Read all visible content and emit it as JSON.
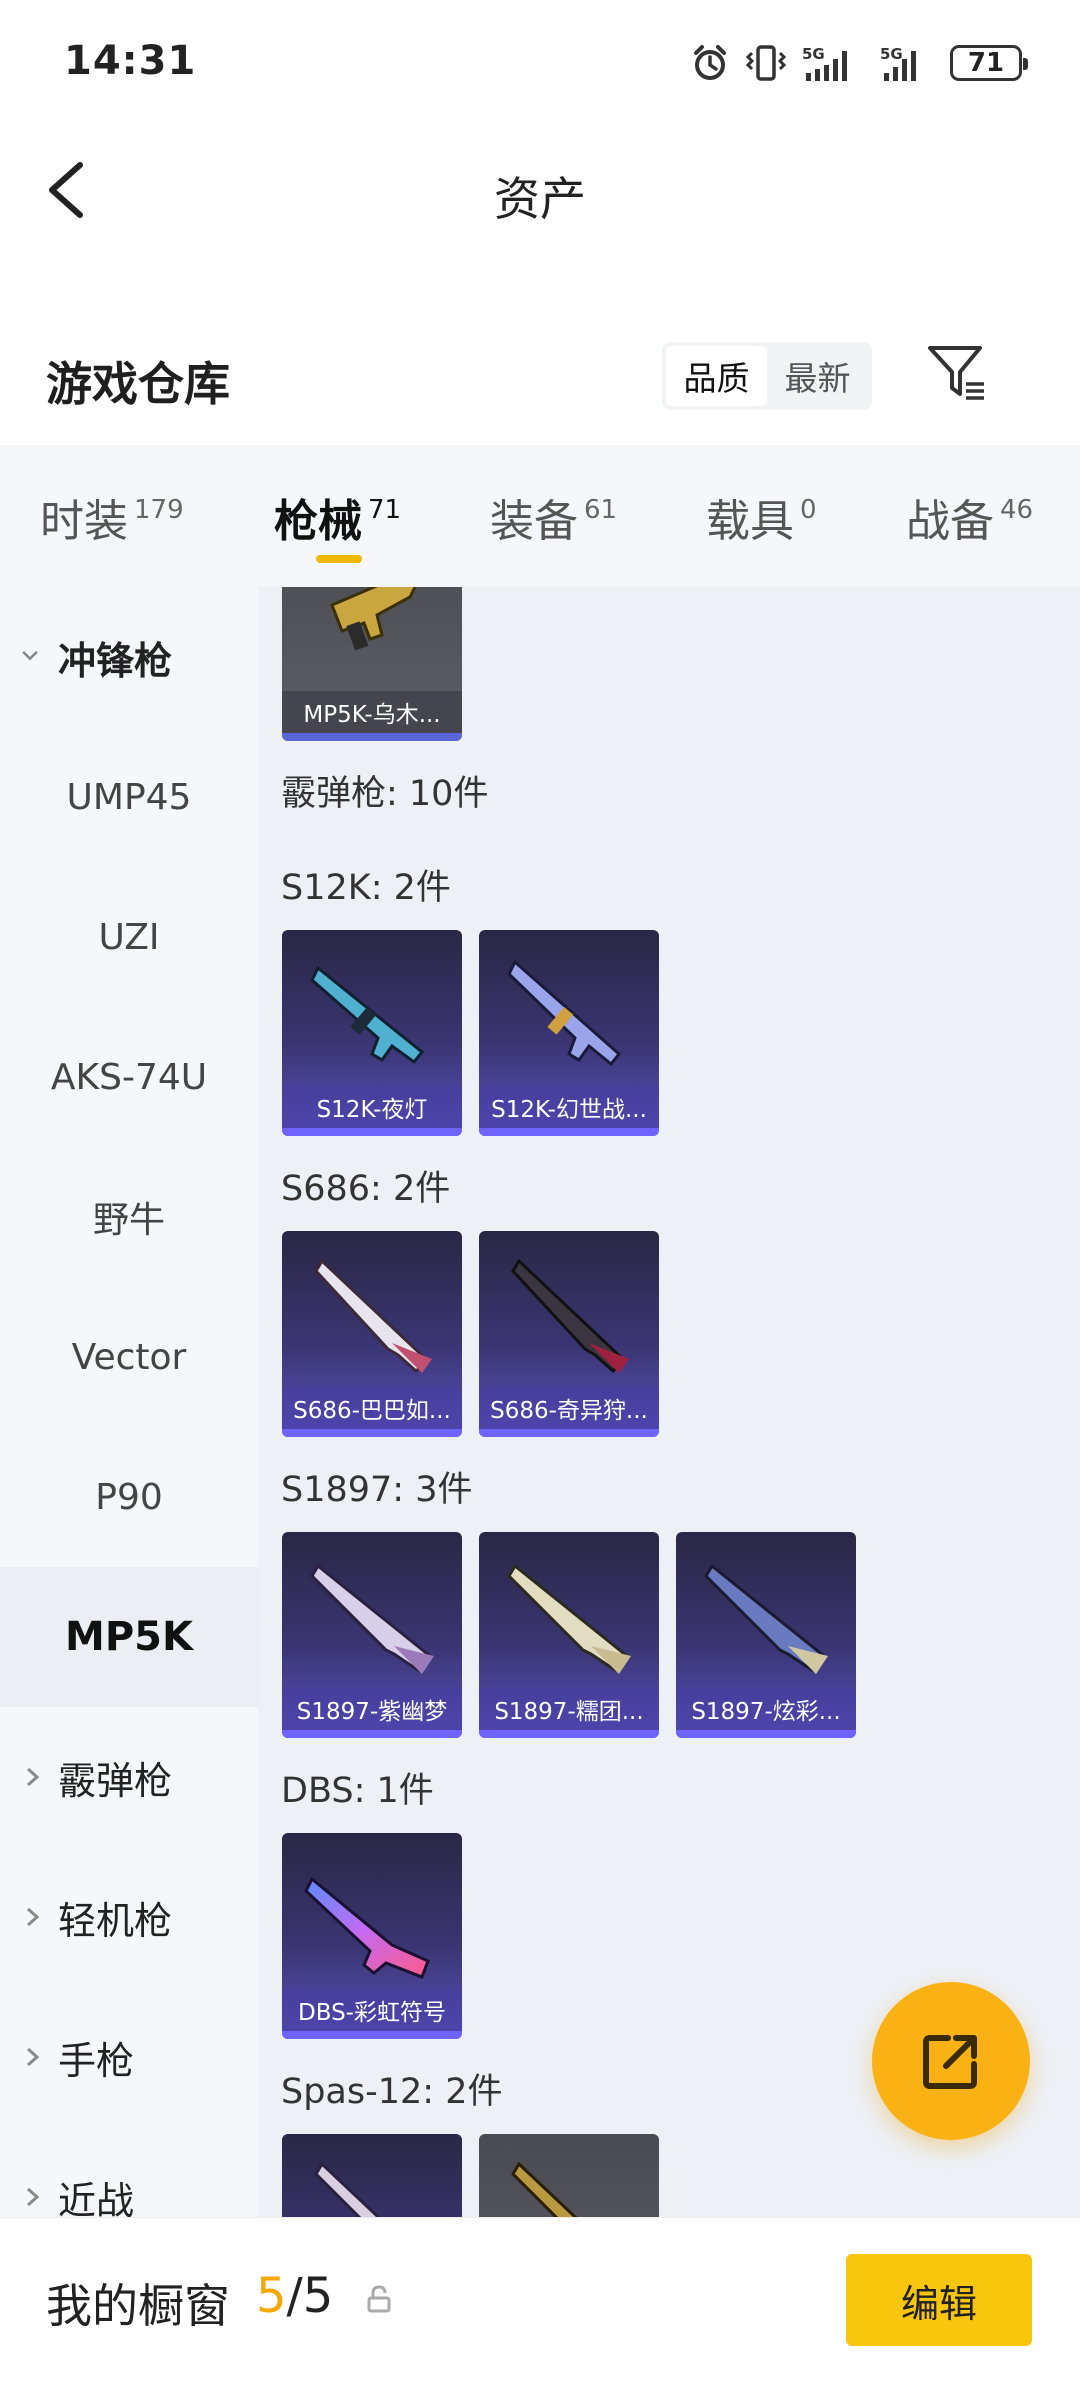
{
  "status_bar": {
    "time": "14:31",
    "battery": "71"
  },
  "nav": {
    "title": "资产"
  },
  "warehouse": {
    "title": "游戏仓库",
    "sort_options": [
      {
        "label": "品质",
        "active": true
      },
      {
        "label": "最新",
        "active": false
      }
    ]
  },
  "tabs": [
    {
      "label": "时装",
      "count": "179"
    },
    {
      "label": "枪械",
      "count": "71",
      "active": true
    },
    {
      "label": "装备",
      "count": "61"
    },
    {
      "label": "载具",
      "count": "0"
    },
    {
      "label": "战备",
      "count": "46"
    }
  ],
  "sidebar": {
    "items": [
      {
        "label": "冲锋枪",
        "type": "group-open"
      },
      {
        "label": "UMP45"
      },
      {
        "label": "UZI"
      },
      {
        "label": "AKS-74U"
      },
      {
        "label": "野牛"
      },
      {
        "label": "Vector"
      },
      {
        "label": "P90"
      },
      {
        "label": "MP5K",
        "selected": true
      },
      {
        "label": "霰弹枪",
        "type": "group"
      },
      {
        "label": "轻机枪",
        "type": "group"
      },
      {
        "label": "手枪",
        "type": "group"
      },
      {
        "label": "近战",
        "type": "group"
      }
    ]
  },
  "content": {
    "top_card": {
      "name": "MP5K-乌木..."
    },
    "category_heading": "霰弹枪: 10件",
    "sections": [
      {
        "title": "S12K: 2件",
        "items": [
          "S12K-夜灯",
          "S12K-幻世战..."
        ]
      },
      {
        "title": "S686: 2件",
        "items": [
          "S686-巴巴如...",
          "S686-奇异狩..."
        ]
      },
      {
        "title": "S1897: 3件",
        "items": [
          "S1897-紫幽梦",
          "S1897-糯团...",
          "S1897-炫彩..."
        ]
      },
      {
        "title": "DBS: 1件",
        "items": [
          "DBS-彩虹符号"
        ]
      },
      {
        "title": "Spas-12: 2件",
        "items": []
      }
    ]
  },
  "bottom": {
    "showcase_label": "我的橱窗",
    "showcase_current": "5",
    "showcase_total": "/5",
    "edit_label": "编辑"
  },
  "colors": {
    "accent": "#f9b113",
    "edit_button": "#f9c60e",
    "card_purple": "#5b52bf"
  }
}
